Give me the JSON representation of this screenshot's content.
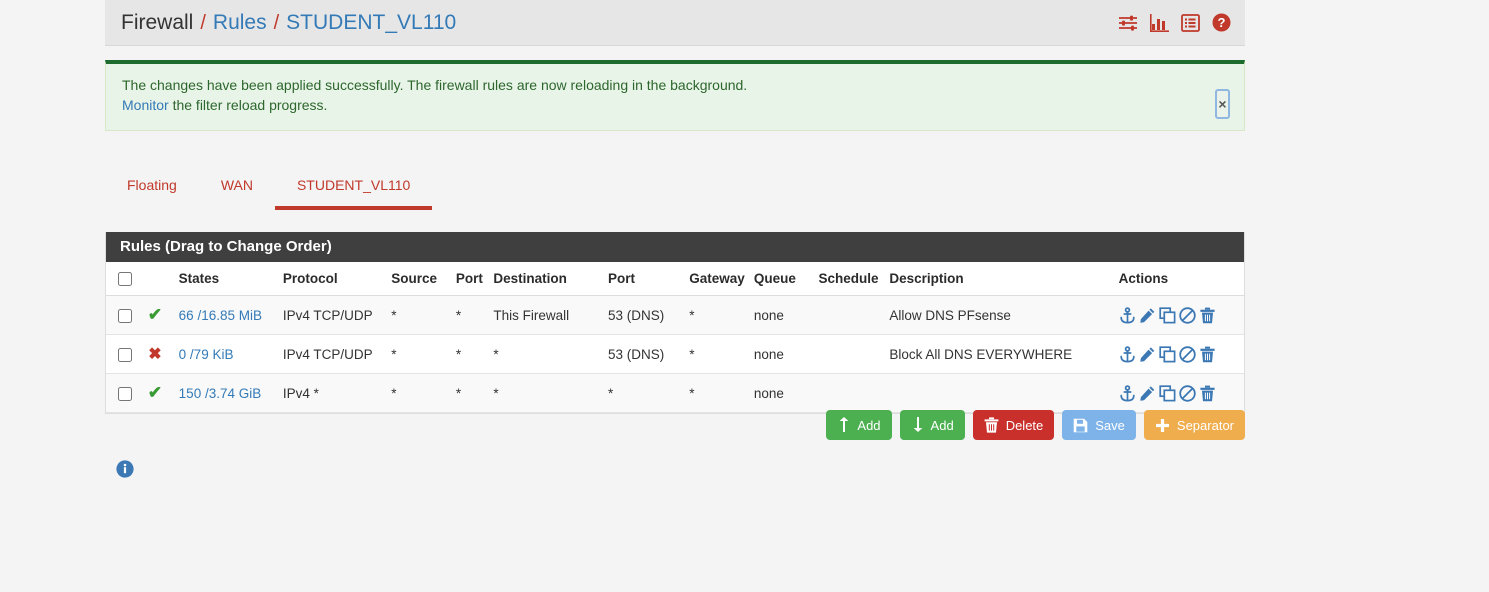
{
  "breadcrumb": {
    "root": "Firewall",
    "separator": "/",
    "link": "Rules",
    "current": "STUDENT_VL110"
  },
  "header_icons": [
    {
      "name": "sliders-icon",
      "label": "Advanced filter"
    },
    {
      "name": "bar-chart-icon",
      "label": "Statistics"
    },
    {
      "name": "list-icon",
      "label": "Log"
    },
    {
      "name": "help-circle-icon",
      "label": "Help"
    }
  ],
  "alert": {
    "line1": "The changes have been applied successfully. The firewall rules are now reloading in the background.",
    "link": "Monitor",
    "line2_rest": " the filter reload progress.",
    "close_label": "×",
    "accent_color": "#1e6b2e",
    "background_color": "#e8f4e8",
    "text_color": "#2d662d"
  },
  "tabs": [
    {
      "label": "Floating",
      "active": false
    },
    {
      "label": "WAN",
      "active": false
    },
    {
      "label": "STUDENT_VL110",
      "active": true
    }
  ],
  "panel": {
    "title": "Rules (Drag to Change Order)",
    "columns": [
      "",
      "",
      "States",
      "Protocol",
      "Source",
      "Port",
      "Destination",
      "Port",
      "Gateway",
      "Queue",
      "Schedule",
      "Description",
      "Actions"
    ],
    "column_labels": {
      "states": "States",
      "protocol": "Protocol",
      "source": "Source",
      "port1": "Port",
      "destination": "Destination",
      "port2": "Port",
      "gateway": "Gateway",
      "queue": "Queue",
      "schedule": "Schedule",
      "description": "Description",
      "actions": "Actions"
    },
    "rows": [
      {
        "status": "pass",
        "status_glyph": "✔",
        "states": "66 /16.85 MiB",
        "protocol": "IPv4 TCP/UDP",
        "source": "*",
        "port1": "*",
        "destination": "This Firewall",
        "port2": "53 (DNS)",
        "gateway": "*",
        "queue": "none",
        "schedule": "",
        "description": "Allow DNS PFsense"
      },
      {
        "status": "block",
        "status_glyph": "✖",
        "states": "0 /79 KiB",
        "protocol": "IPv4 TCP/UDP",
        "source": "*",
        "port1": "*",
        "destination": "*",
        "port2": "53 (DNS)",
        "gateway": "*",
        "queue": "none",
        "schedule": "",
        "description": "Block All DNS EVERYWHERE"
      },
      {
        "status": "pass",
        "status_glyph": "✔",
        "states": "150 /3.74 GiB",
        "protocol": "IPv4 *",
        "source": "*",
        "port1": "*",
        "destination": "*",
        "port2": "*",
        "gateway": "*",
        "queue": "none",
        "schedule": "",
        "description": ""
      }
    ],
    "row_action_icons": [
      "anchor-icon",
      "pencil-edit-icon",
      "copy-icon",
      "disable-ban-icon",
      "trash-delete-icon"
    ]
  },
  "buttons": [
    {
      "label": "Add",
      "icon": "arrow-up-icon",
      "color": "#4caf50",
      "style": "btn-green"
    },
    {
      "label": "Add",
      "icon": "arrow-down-icon",
      "color": "#4caf50",
      "style": "btn-green"
    },
    {
      "label": "Delete",
      "icon": "trash-icon",
      "color": "#c9302c",
      "style": "btn-red"
    },
    {
      "label": "Save",
      "icon": "floppy-save-icon",
      "color": "#7db3e8",
      "style": "btn-blue"
    },
    {
      "label": "Separator",
      "icon": "plus-icon",
      "color": "#f0ad4e",
      "style": "btn-orange"
    }
  ],
  "footer": {
    "info_icon": "info-circle-icon"
  },
  "colors": {
    "page_background": "#f4f4f4",
    "panel_header": "#3f3f3f",
    "link_blue": "#337ab7",
    "tab_red": "#c0392b",
    "pass_green": "#3a9b35",
    "block_red": "#c0392b",
    "action_icon_blue": "#3c78b4"
  }
}
